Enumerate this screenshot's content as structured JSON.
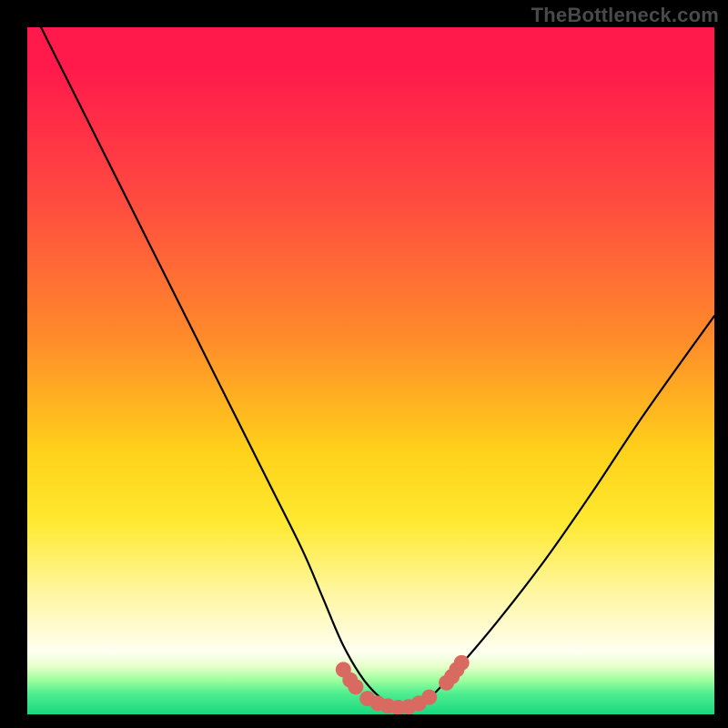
{
  "watermark": "TheBottleneck.com",
  "chart_data": {
    "type": "line",
    "title": "",
    "xlabel": "",
    "ylabel": "",
    "xlim": [
      0,
      100
    ],
    "ylim": [
      0,
      100
    ],
    "series": [
      {
        "name": "bottleneck_curve",
        "x": [
          2,
          6,
          10,
          15,
          20,
          25,
          30,
          35,
          40,
          43,
          46,
          49,
          52,
          55,
          58,
          62,
          68,
          75,
          82,
          90,
          100
        ],
        "y": [
          100,
          92,
          84,
          74,
          64,
          54,
          44,
          34,
          24,
          17,
          10,
          5,
          2,
          1,
          2,
          6,
          13,
          22,
          32,
          44,
          58
        ]
      }
    ],
    "markers": {
      "name": "highlighted_range",
      "color": "#d86a62",
      "points": [
        {
          "x": 46.0,
          "y": 6.5
        },
        {
          "x": 47.0,
          "y": 5.0
        },
        {
          "x": 47.8,
          "y": 4.0
        },
        {
          "x": 49.5,
          "y": 2.3
        },
        {
          "x": 51.0,
          "y": 1.6
        },
        {
          "x": 52.5,
          "y": 1.2
        },
        {
          "x": 54.0,
          "y": 1.0
        },
        {
          "x": 55.5,
          "y": 1.1
        },
        {
          "x": 57.0,
          "y": 1.6
        },
        {
          "x": 58.5,
          "y": 2.5
        },
        {
          "x": 61.0,
          "y": 4.6
        },
        {
          "x": 61.8,
          "y": 5.5
        },
        {
          "x": 62.5,
          "y": 6.5
        },
        {
          "x": 63.2,
          "y": 7.5
        }
      ]
    },
    "gradient_stops": [
      {
        "pos": 0.0,
        "color": "#ff1a4b"
      },
      {
        "pos": 0.25,
        "color": "#ff4a40"
      },
      {
        "pos": 0.45,
        "color": "#ff8a2a"
      },
      {
        "pos": 0.72,
        "color": "#ffe930"
      },
      {
        "pos": 0.88,
        "color": "#fffcd6"
      },
      {
        "pos": 0.95,
        "color": "#9eff9e"
      },
      {
        "pos": 1.0,
        "color": "#1ad87f"
      }
    ]
  }
}
